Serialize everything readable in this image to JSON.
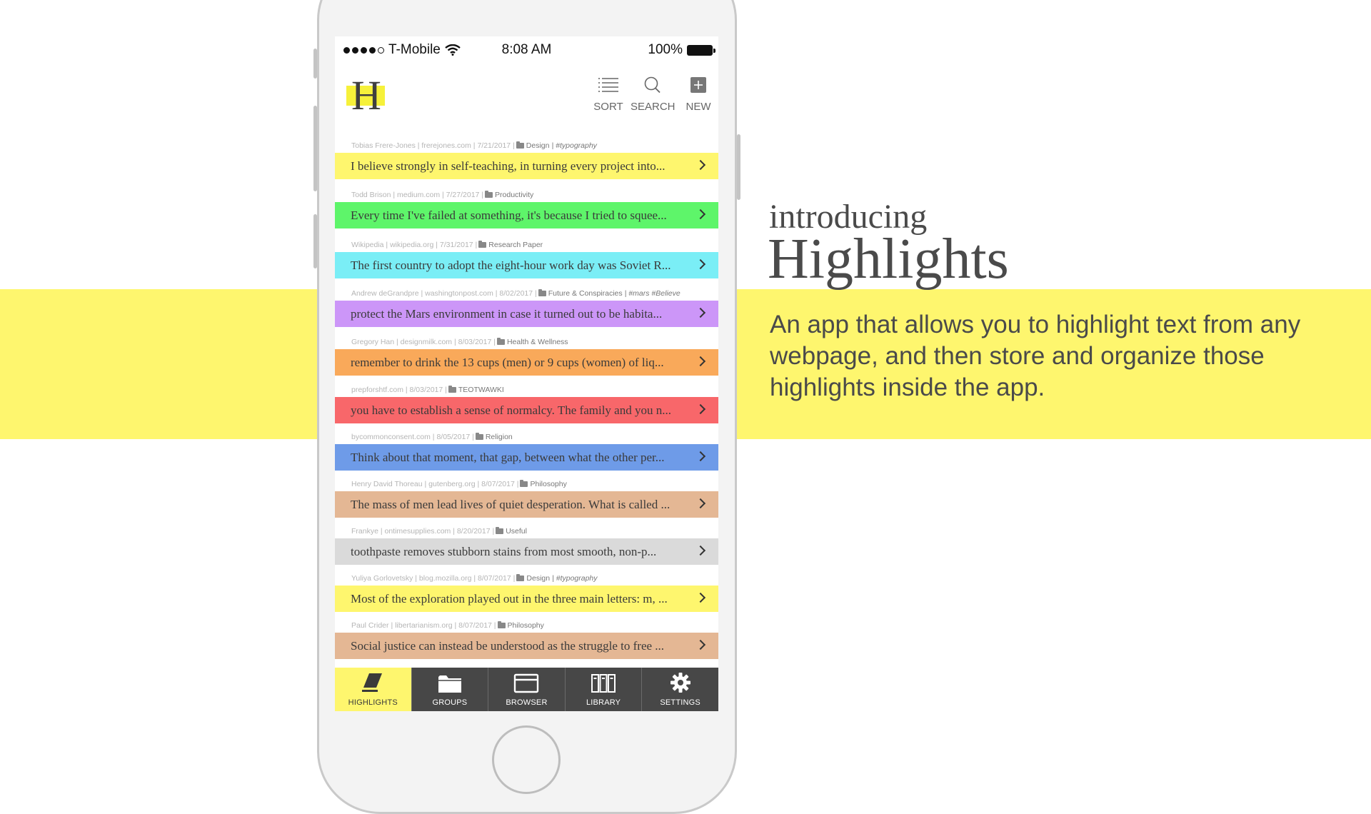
{
  "colors": {
    "band": "#fef66e",
    "yellow": "#fef66e",
    "green": "#5ef56a",
    "cyan": "#7aeef6",
    "purple": "#cc96f8",
    "orange": "#f9a95a",
    "red": "#f8676a",
    "blue": "#6e9be8",
    "tan": "#e4b794",
    "gray": "#dadada",
    "tabbar": "#474747"
  },
  "status_bar": {
    "carrier": "T-Mobile",
    "time": "8:08 AM",
    "battery": "100%"
  },
  "header": {
    "logo_letter": "H",
    "sort_label": "SORT",
    "search_label": "SEARCH",
    "new_label": "NEW"
  },
  "highlights": [
    {
      "meta": "Tobias Frere-Jones | frerejones.com | 7/21/2017 |",
      "group": "Design",
      "tags": "| #typography",
      "text": "I believe strongly in self-teaching, in turning every project into...",
      "color": "yellow"
    },
    {
      "meta": "Todd Brison | medium.com | 7/27/2017 |",
      "group": "Productivity",
      "tags": "",
      "text": "Every time I've failed at something, it's because I tried to squee...",
      "color": "green"
    },
    {
      "meta": "Wikipedia | wikipedia.org | 7/31/2017 |",
      "group": "Research Paper",
      "tags": "",
      "text": "The first country to adopt the eight-hour work day was Soviet R...",
      "color": "cyan"
    },
    {
      "meta": "Andrew deGrandpre | washingtonpost.com | 8/02/2017 |",
      "group": "Future & Conspiracies",
      "tags": "| #mars #Believe",
      "text": "protect the Mars environment in case it turned out to be habita...",
      "color": "purple"
    },
    {
      "meta": "Gregory Han | designmilk.com | 8/03/2017 |",
      "group": "Health & Wellness",
      "tags": "",
      "text": "remember to drink the 13 cups (men) or 9 cups (women) of liq...",
      "color": "orange"
    },
    {
      "meta": "prepforshtf.com | 8/03/2017 |",
      "group": "TEOTWAWKI",
      "tags": "",
      "text": "you have to establish a sense of normalcy. The family and you n...",
      "color": "red"
    },
    {
      "meta": "bycommonconsent.com | 8/05/2017 |",
      "group": "Religion",
      "tags": "",
      "text": "Think about that moment, that gap, between what the other per...",
      "color": "blue"
    },
    {
      "meta": "Henry David Thoreau | gutenberg.org | 8/07/2017 |",
      "group": "Philosophy",
      "tags": "",
      "text": "The mass of men lead lives of quiet desperation. What is called ...",
      "color": "tan"
    },
    {
      "meta": "Frankye | ontimesupplies.com | 8/20/2017 |",
      "group": "Useful",
      "tags": "",
      "text": "toothpaste removes stubborn stains from most smooth, non-p...",
      "color": "gray"
    },
    {
      "meta": "Yuliya Gorlovetsky | blog.mozilla.org | 8/07/2017 |",
      "group": "Design",
      "tags": "| #typography",
      "text": "Most of the exploration played out in the three main letters: m, ...",
      "color": "yellow"
    },
    {
      "meta": "Paul Crider | libertarianism.org | 8/07/2017 |",
      "group": "Philosophy",
      "tags": "",
      "text": "Social justice can instead be understood as the struggle to free ...",
      "color": "tan"
    }
  ],
  "tabs": [
    {
      "label": "HIGHLIGHTS",
      "icon": "highlighter-icon",
      "active": true
    },
    {
      "label": "GROUPS",
      "icon": "folder-icon",
      "active": false
    },
    {
      "label": "BROWSER",
      "icon": "browser-window-icon",
      "active": false
    },
    {
      "label": "LIBRARY",
      "icon": "library-books-icon",
      "active": false
    },
    {
      "label": "SETTINGS",
      "icon": "gear-icon",
      "active": false
    }
  ],
  "promo": {
    "intro": "introducing",
    "headline": "Highlights",
    "description": "An app that allows you to highlight text from any webpage, and then store and organize those highlights inside the app."
  }
}
